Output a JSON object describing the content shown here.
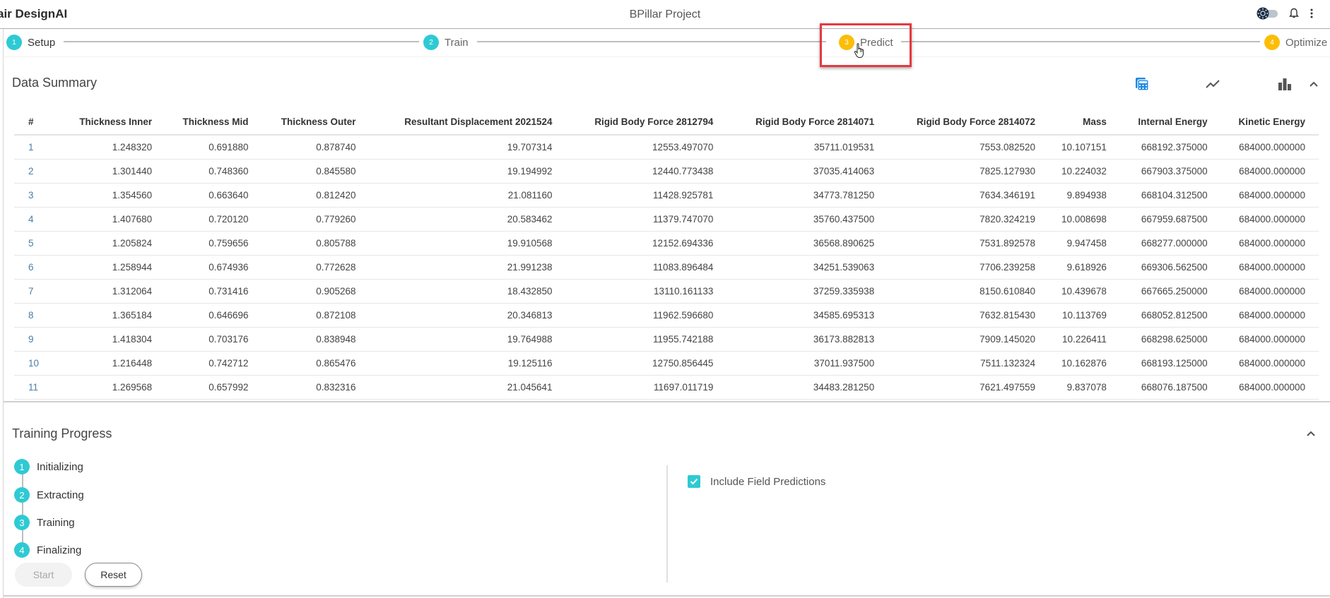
{
  "header": {
    "app_title": "air DesignAI",
    "project_title": "BPillar Project",
    "icons": [
      "theme-toggle-icon",
      "bell-icon",
      "more-vert-icon"
    ]
  },
  "workflow_steps": [
    {
      "number": "1",
      "label": "Setup",
      "state": "active",
      "color": "#2ecad4"
    },
    {
      "number": "2",
      "label": "Train",
      "state": "complete",
      "color": "#2ecad4"
    },
    {
      "number": "3",
      "label": "Predict",
      "state": "pending",
      "color": "#fbbd08"
    },
    {
      "number": "4",
      "label": "Optimize",
      "state": "pending",
      "color": "#fbbd08"
    }
  ],
  "data_summary": {
    "title": "Data Summary",
    "tools": [
      "calculator-icon",
      "line-chart-icon",
      "bar-chart-icon",
      "chevron-up-icon"
    ],
    "columns": [
      "#",
      "Thickness Inner",
      "Thickness Mid",
      "Thickness Outer",
      "Resultant Displacement 2021524",
      "Rigid Body Force 2812794",
      "Rigid Body Force 2814071",
      "Rigid Body Force 2814072",
      "Mass",
      "Internal Energy",
      "Kinetic Energy"
    ],
    "rows": [
      [
        "1",
        "1.248320",
        "0.691880",
        "0.878740",
        "19.707314",
        "12553.497070",
        "35711.019531",
        "7553.082520",
        "10.107151",
        "668192.375000",
        "684000.000000"
      ],
      [
        "2",
        "1.301440",
        "0.748360",
        "0.845580",
        "19.194992",
        "12440.773438",
        "37035.414063",
        "7825.127930",
        "10.224032",
        "667903.375000",
        "684000.000000"
      ],
      [
        "3",
        "1.354560",
        "0.663640",
        "0.812420",
        "21.081160",
        "11428.925781",
        "34773.781250",
        "7634.346191",
        "9.894938",
        "668104.312500",
        "684000.000000"
      ],
      [
        "4",
        "1.407680",
        "0.720120",
        "0.779260",
        "20.583462",
        "11379.747070",
        "35760.437500",
        "7820.324219",
        "10.008698",
        "667959.687500",
        "684000.000000"
      ],
      [
        "5",
        "1.205824",
        "0.759656",
        "0.805788",
        "19.910568",
        "12152.694336",
        "36568.890625",
        "7531.892578",
        "9.947458",
        "668277.000000",
        "684000.000000"
      ],
      [
        "6",
        "1.258944",
        "0.674936",
        "0.772628",
        "21.991238",
        "11083.896484",
        "34251.539063",
        "7706.239258",
        "9.618926",
        "669306.562500",
        "684000.000000"
      ],
      [
        "7",
        "1.312064",
        "0.731416",
        "0.905268",
        "18.432850",
        "13110.161133",
        "37259.335938",
        "8150.610840",
        "10.439678",
        "667665.250000",
        "684000.000000"
      ],
      [
        "8",
        "1.365184",
        "0.646696",
        "0.872108",
        "20.346813",
        "11962.596680",
        "34585.695313",
        "7632.815430",
        "10.113769",
        "668052.812500",
        "684000.000000"
      ],
      [
        "9",
        "1.418304",
        "0.703176",
        "0.838948",
        "19.764988",
        "11955.742188",
        "36173.882813",
        "7909.145020",
        "10.226411",
        "668298.625000",
        "684000.000000"
      ],
      [
        "10",
        "1.216448",
        "0.742712",
        "0.865476",
        "19.125116",
        "12750.856445",
        "37011.937500",
        "7511.132324",
        "10.162876",
        "668193.125000",
        "684000.000000"
      ],
      [
        "11",
        "1.269568",
        "0.657992",
        "0.832316",
        "21.045641",
        "11697.011719",
        "34483.281250",
        "7621.497559",
        "9.837078",
        "668076.187500",
        "684000.000000"
      ]
    ]
  },
  "training_progress": {
    "title": "Training Progress",
    "steps": [
      {
        "number": "1",
        "label": "Initializing"
      },
      {
        "number": "2",
        "label": "Extracting"
      },
      {
        "number": "3",
        "label": "Training"
      },
      {
        "number": "4",
        "label": "Finalizing"
      }
    ],
    "start_label": "Start",
    "start_disabled": true,
    "reset_label": "Reset",
    "include_field_predictions": {
      "label": "Include Field Predictions",
      "checked": true
    }
  },
  "colors": {
    "accent_teal": "#2ecad4",
    "accent_yellow": "#fbbd08",
    "highlight_red": "#e5393f",
    "icon_blue": "#1e88e5"
  }
}
